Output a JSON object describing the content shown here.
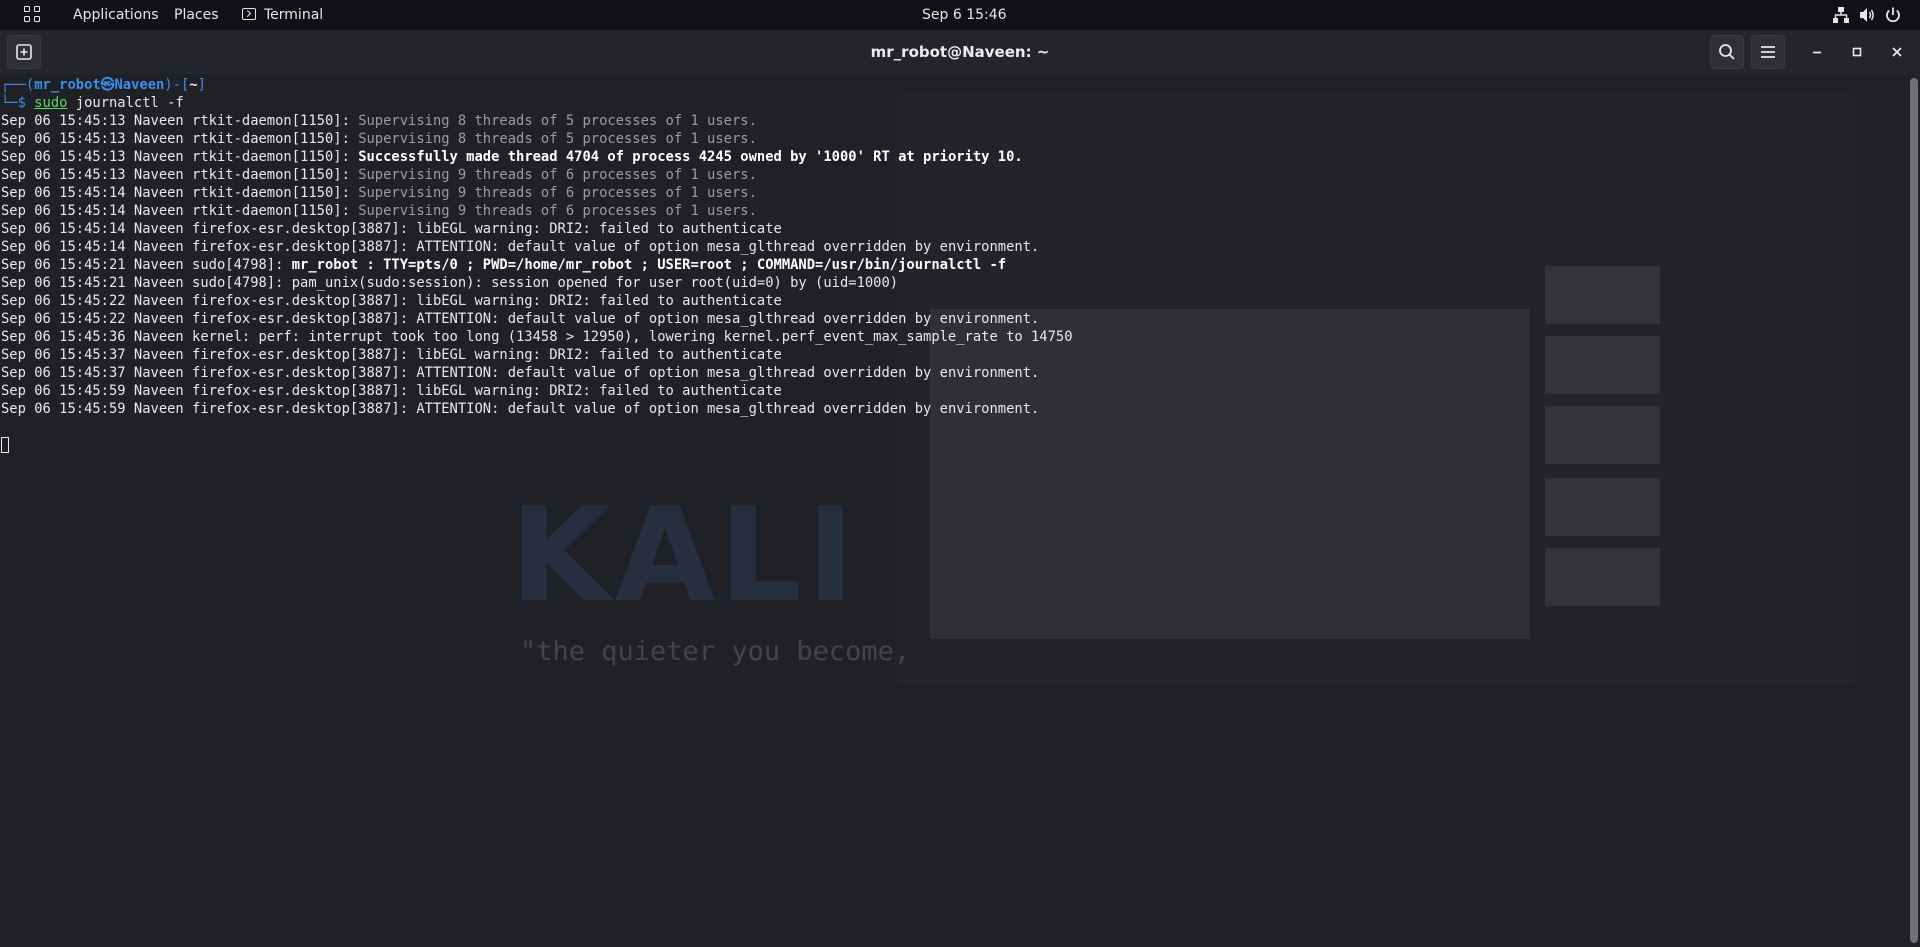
{
  "topbar": {
    "applications": "Applications",
    "places": "Places",
    "terminal": "Terminal",
    "clock": "Sep 6  15:46",
    "icons": [
      "apps-grid-icon",
      "terminal-icon",
      "network-icon",
      "volume-icon",
      "power-icon"
    ]
  },
  "window": {
    "title": "mr_robot@Naveen: ~",
    "icons": [
      "new-tab-icon",
      "search-icon",
      "hamburger-menu-icon",
      "minimize-icon",
      "maximize-icon",
      "close-icon"
    ]
  },
  "prompt": {
    "open": "┌──(",
    "user": "mr_robot㉿Naveen",
    "mid": ")-[",
    "dir": "~",
    "close": "]",
    "arrow": "└─$ ",
    "cmd": "sudo",
    "args": " journalctl -f"
  },
  "log": [
    {
      "prefix": "Sep 06 15:45:13 Naveen rtkit-daemon[1150]: ",
      "msg": "Supervising 8 threads of 5 processes of 1 users.",
      "style": "dim"
    },
    {
      "prefix": "Sep 06 15:45:13 Naveen rtkit-daemon[1150]: ",
      "msg": "Supervising 8 threads of 5 processes of 1 users.",
      "style": "dim"
    },
    {
      "prefix": "Sep 06 15:45:13 Naveen rtkit-daemon[1150]: ",
      "msg": "Successfully made thread 4704 of process 4245 owned by '1000' RT at priority 10.",
      "style": "bold"
    },
    {
      "prefix": "Sep 06 15:45:13 Naveen rtkit-daemon[1150]: ",
      "msg": "Supervising 9 threads of 6 processes of 1 users.",
      "style": "dim"
    },
    {
      "prefix": "Sep 06 15:45:14 Naveen rtkit-daemon[1150]: ",
      "msg": "Supervising 9 threads of 6 processes of 1 users.",
      "style": "dim"
    },
    {
      "prefix": "Sep 06 15:45:14 Naveen rtkit-daemon[1150]: ",
      "msg": "Supervising 9 threads of 6 processes of 1 users.",
      "style": "dim"
    },
    {
      "prefix": "Sep 06 15:45:14 Naveen firefox-esr.desktop[3887]: ",
      "msg": "libEGL warning: DRI2: failed to authenticate",
      "style": "normal"
    },
    {
      "prefix": "Sep 06 15:45:14 Naveen firefox-esr.desktop[3887]: ",
      "msg": "ATTENTION: default value of option mesa_glthread overridden by environment.",
      "style": "normal"
    },
    {
      "prefix": "Sep 06 15:45:21 Naveen sudo[4798]: ",
      "msg": "mr_robot : TTY=pts/0 ; PWD=/home/mr_robot ; USER=root ; COMMAND=/usr/bin/journalctl -f",
      "style": "bold"
    },
    {
      "prefix": "Sep 06 15:45:21 Naveen sudo[4798]: ",
      "msg": "pam_unix(sudo:session): session opened for user root(uid=0) by (uid=1000)",
      "style": "normal"
    },
    {
      "prefix": "Sep 06 15:45:22 Naveen firefox-esr.desktop[3887]: ",
      "msg": "libEGL warning: DRI2: failed to authenticate",
      "style": "normal"
    },
    {
      "prefix": "Sep 06 15:45:22 Naveen firefox-esr.desktop[3887]: ",
      "msg": "ATTENTION: default value of option mesa_glthread overridden by environment.",
      "style": "normal"
    },
    {
      "prefix": "Sep 06 15:45:36 Naveen kernel: ",
      "msg": "perf: interrupt took too long (13458 > 12950), lowering kernel.perf_event_max_sample_rate to 14750",
      "style": "normal"
    },
    {
      "prefix": "Sep 06 15:45:37 Naveen firefox-esr.desktop[3887]: ",
      "msg": "libEGL warning: DRI2: failed to authenticate",
      "style": "normal"
    },
    {
      "prefix": "Sep 06 15:45:37 Naveen firefox-esr.desktop[3887]: ",
      "msg": "ATTENTION: default value of option mesa_glthread overridden by environment.",
      "style": "normal"
    },
    {
      "prefix": "Sep 06 15:45:59 Naveen firefox-esr.desktop[3887]: ",
      "msg": "libEGL warning: DRI2: failed to authenticate",
      "style": "normal"
    },
    {
      "prefix": "Sep 06 15:45:59 Naveen firefox-esr.desktop[3887]: ",
      "msg": "ATTENTION: default value of option mesa_glthread overridden by environment.",
      "style": "normal"
    }
  ],
  "wallpaper": {
    "logo": "KALI",
    "quote": "\"the quieter you become,"
  },
  "colors": {
    "prompt_blue": "#3b8eea",
    "command_green": "#5fd75f",
    "dim_text": "#9a9ca0",
    "background": "#1f2126"
  }
}
